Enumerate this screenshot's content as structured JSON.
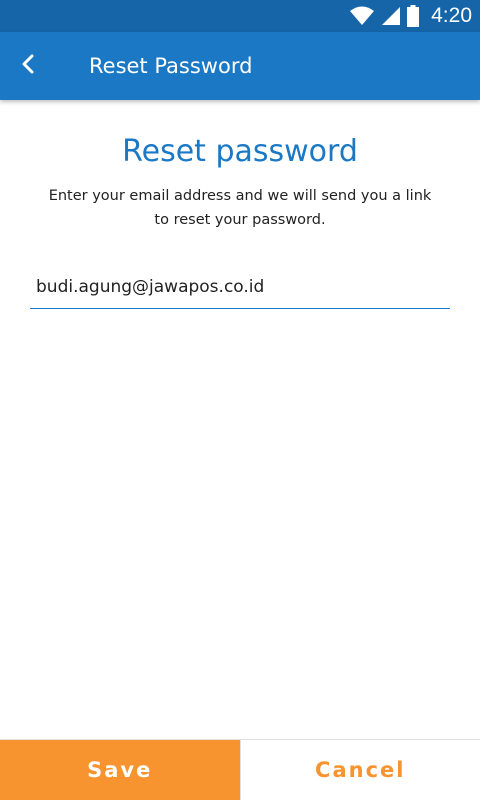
{
  "status_bar": {
    "time": "4:20",
    "icons": [
      "wifi-icon",
      "signal-icon",
      "battery-icon"
    ]
  },
  "app_bar": {
    "back_icon": "chevron-left-icon",
    "title": "Reset Password"
  },
  "content": {
    "heading": "Reset password",
    "description_line1": "Enter your email address and we will send you a link",
    "description_line2": "to reset your password.",
    "email_value": "budi.agung@jawapos.co.id"
  },
  "actions": {
    "save_label": "Save",
    "cancel_label": "Cancel"
  },
  "colors": {
    "status_bar": "#1565a8",
    "app_bar": "#1b78c4",
    "accent_orange": "#f7942f",
    "heading_blue": "#1b78c4"
  }
}
